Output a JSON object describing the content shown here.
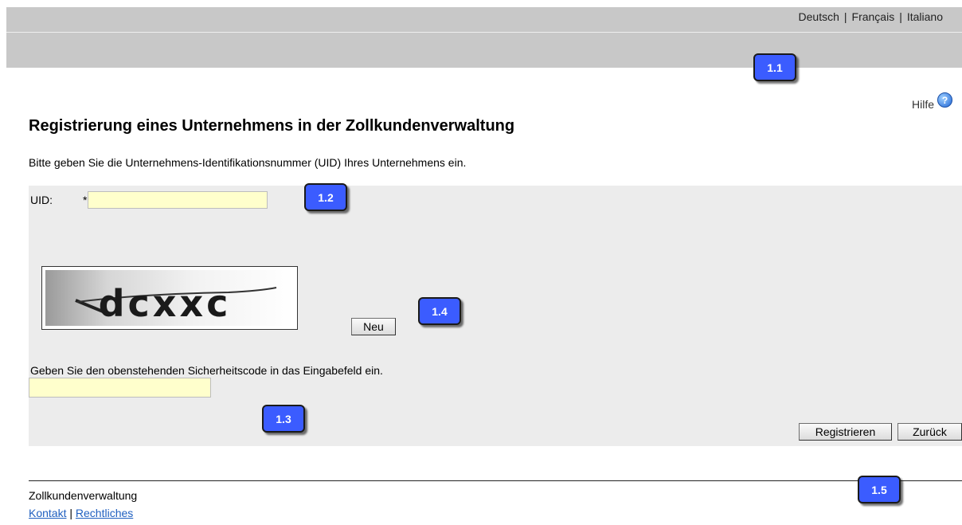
{
  "languages": [
    "Deutsch",
    "Français",
    "Italiano"
  ],
  "help": {
    "label": "Hilfe",
    "icon": "question-circle-icon",
    "icon_glyph": "?"
  },
  "page": {
    "title": "Registrierung eines Unternehmens in der Zollkundenverwaltung",
    "intro": "Bitte geben Sie die Unternehmens-Identifikationsnummer (UID) Ihres Unternehmens ein."
  },
  "form": {
    "uid_label": "UID:",
    "required_marker": "*",
    "uid_value": "",
    "captcha_text": "dcxxc",
    "refresh_label": "Neu",
    "captcha_prompt": "Geben Sie den obenstehenden Sicherheitscode in das Eingabefeld ein.",
    "code_value": "",
    "register_label": "Registrieren",
    "back_label": "Zurück"
  },
  "footer": {
    "title": "Zollkundenverwaltung",
    "links": [
      "Kontakt",
      "Rechtliches"
    ],
    "separator": "|"
  },
  "callouts": [
    "1.1",
    "1.2",
    "1.3",
    "1.4",
    "1.5"
  ],
  "colors": {
    "callout_bg": "#3b5cff",
    "input_bg": "#ffffcc",
    "header_bg": "#c8c8c8",
    "panel_bg": "#ececec",
    "link": "#2060c0"
  }
}
